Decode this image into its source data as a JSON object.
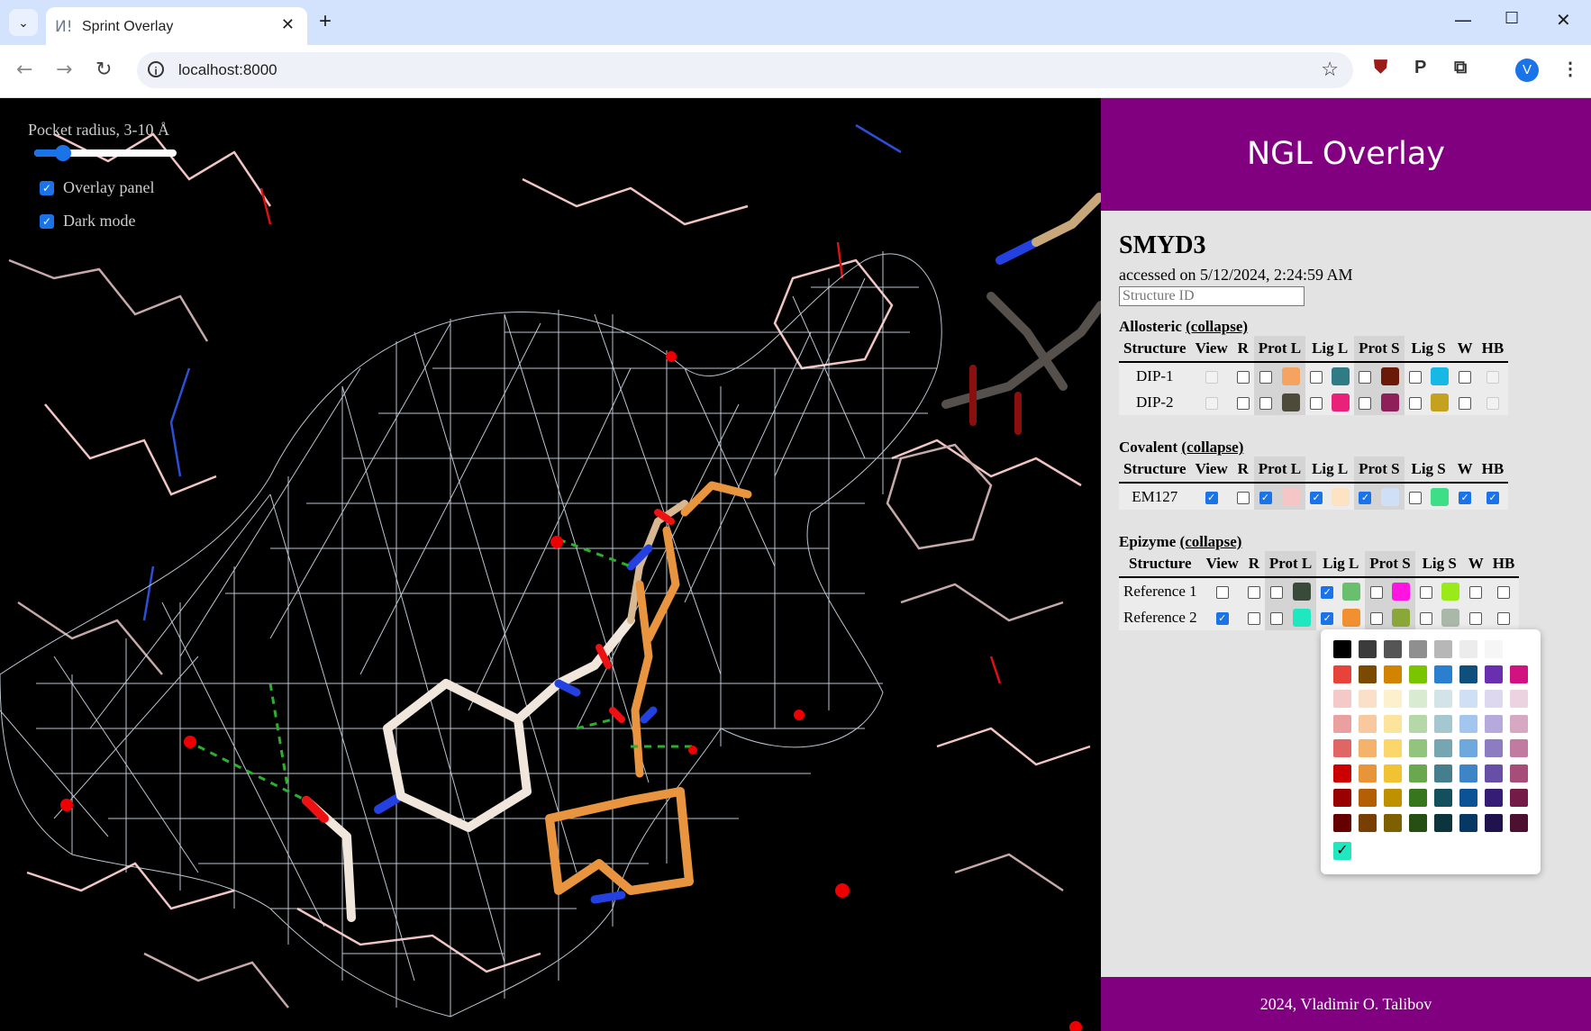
{
  "browser": {
    "tab_title": "Sprint Overlay",
    "favicon": "И!",
    "url": "localhost:8000",
    "avatar_letter": "V"
  },
  "viewer": {
    "pocket_label": "Pocket radius, 3-10 Å",
    "pocket_radius_value": 0.2,
    "overlay_panel_label": "Overlay panel",
    "overlay_panel_checked": true,
    "dark_mode_label": "Dark mode",
    "dark_mode_checked": true
  },
  "panel": {
    "header": "NGL Overlay",
    "structure": "SMYD3",
    "accessed": "accessed on 5/12/2024, 2:24:59 AM",
    "structure_id_placeholder": "Structure ID",
    "footer": "2024, Vladimir O. Talibov",
    "columns": [
      "Structure",
      "View",
      "R",
      "Prot L",
      "Lig L",
      "Prot S",
      "Lig S",
      "W",
      "HB"
    ],
    "groups": [
      {
        "name": "Allosteric",
        "collapse": "(collapse)",
        "rows": [
          {
            "name": "DIP-1",
            "view": "disabled",
            "r": false,
            "protL": false,
            "protL_color": "#f4a460",
            "ligL": false,
            "ligL_color": "#2f7c86",
            "protS": false,
            "protS_color": "#6b1a08",
            "ligS": false,
            "ligS_color": "#17b8e6",
            "w": false,
            "hb": "disabled"
          },
          {
            "name": "DIP-2",
            "view": "disabled",
            "r": false,
            "protL": false,
            "protL_color": "#4d4a3c",
            "ligL": false,
            "ligL_color": "#e8227a",
            "protS": false,
            "protS_color": "#8e1f5a",
            "ligS": false,
            "ligS_color": "#c4a11e",
            "w": false,
            "hb": "disabled"
          }
        ]
      },
      {
        "name": "Covalent",
        "collapse": "(collapse)",
        "rows": [
          {
            "name": "EM127",
            "view": true,
            "r": false,
            "protL": true,
            "protL_color": "#f6c6c6",
            "ligL": true,
            "ligL_color": "#fde3c4",
            "protS": true,
            "protS_color": "#cfe0f6",
            "ligS": false,
            "ligS_color": "#3ede86",
            "w": true,
            "hb": true
          }
        ]
      },
      {
        "name": "Epizyme",
        "collapse": "(collapse)",
        "rows": [
          {
            "name": "Reference 1",
            "view": false,
            "r": false,
            "protL": false,
            "protL_color": "#3a4a3a",
            "ligL": true,
            "ligL_color": "#6abf6e",
            "protS": false,
            "protS_color": "#ff14e0",
            "ligS": false,
            "ligS_color": "#9aea1a",
            "w": false,
            "hb": false
          },
          {
            "name": "Reference 2",
            "view": true,
            "r": false,
            "protL": false,
            "protL_color": "#1fe8c0",
            "ligL": true,
            "ligL_color": "#f09030",
            "protS": false,
            "protS_color": "#8aa83a",
            "ligS": false,
            "ligS_color": "#a9b8a9",
            "w": false,
            "hb": false
          }
        ]
      }
    ],
    "palette": [
      [
        "#000000",
        "#3b3b3b",
        "#555555",
        "#8f8f8f",
        "#b7b7b7",
        "#ececec",
        "#f6f6f6",
        "#ffffff"
      ],
      [
        "#e8433a",
        "#7a4a00",
        "#d28400",
        "#7bc400",
        "#2b7fcf",
        "#0f4f7d",
        "#6a2fb0",
        "#d21280"
      ],
      [
        "#f6c9c9",
        "#fbe0c9",
        "#fdf0cc",
        "#d9ebd1",
        "#d3e4e8",
        "#cfe0f4",
        "#ddd8ef",
        "#ebd3e0"
      ],
      [
        "#eba0a0",
        "#f8c99e",
        "#fde49d",
        "#b6d7a8",
        "#a4c7d0",
        "#a3c6ee",
        "#b6a9dc",
        "#d6a8c2"
      ],
      [
        "#e06666",
        "#f4b26b",
        "#fdd66b",
        "#93c47d",
        "#75a6b2",
        "#6fa8dc",
        "#8e7cc3",
        "#c27ba0"
      ],
      [
        "#cc0000",
        "#e8953a",
        "#f1c232",
        "#6aa84f",
        "#457e8c",
        "#3d85c6",
        "#674ea7",
        "#a64d79"
      ],
      [
        "#990000",
        "#b45f06",
        "#bf9000",
        "#38761d",
        "#134f5c",
        "#0b5394",
        "#351c75",
        "#741b47"
      ],
      [
        "#660000",
        "#783f04",
        "#7f6000",
        "#274e13",
        "#0c343d",
        "#073763",
        "#20124d",
        "#4c1130"
      ]
    ],
    "palette_selected": "#1fe8c0"
  }
}
